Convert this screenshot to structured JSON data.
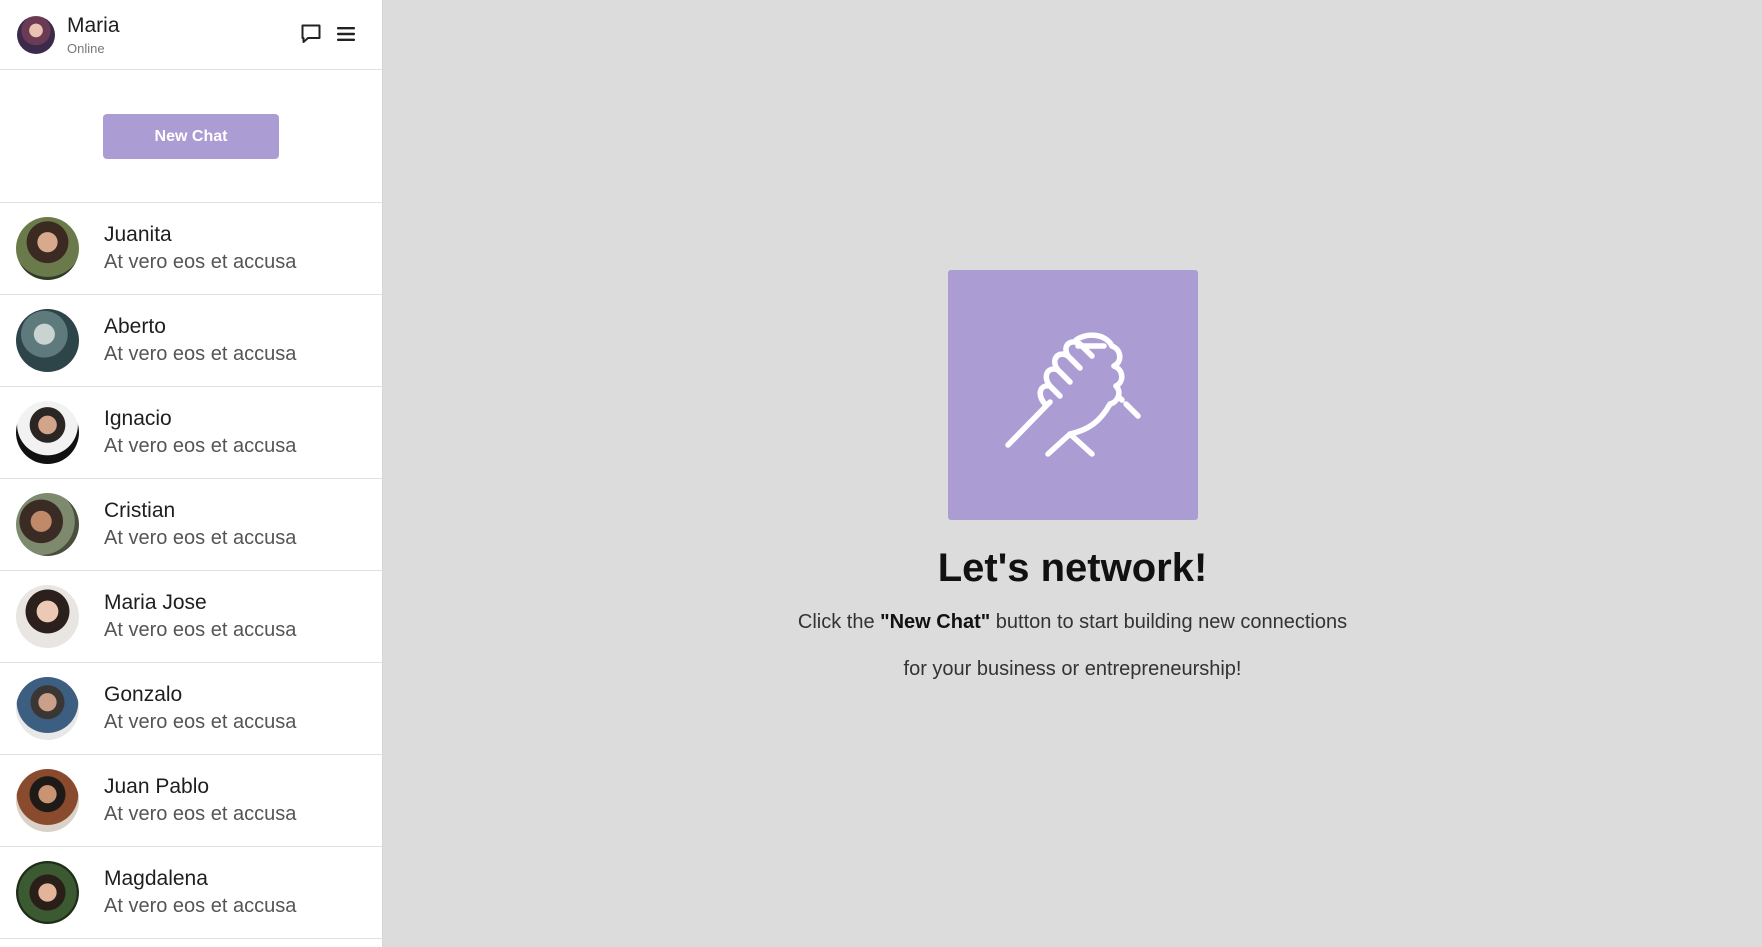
{
  "user": {
    "name": "Maria",
    "status": "Online"
  },
  "header_icons": [
    "chat-bubble-icon",
    "menu-icon"
  ],
  "new_chat_label": "New Chat",
  "contacts": [
    {
      "name": "Juanita",
      "preview": "At vero eos et accusa"
    },
    {
      "name": "Aberto",
      "preview": "At vero eos et accusa"
    },
    {
      "name": "Ignacio",
      "preview": "At vero eos et accusa"
    },
    {
      "name": "Cristian",
      "preview": "At vero eos et accusa"
    },
    {
      "name": "Maria Jose",
      "preview": "At vero eos et accusa"
    },
    {
      "name": "Gonzalo",
      "preview": "At vero eos et accusa"
    },
    {
      "name": "Juan Pablo",
      "preview": "At vero eos et accusa"
    },
    {
      "name": "Magdalena",
      "preview": "At vero eos et accusa"
    }
  ],
  "empty_state": {
    "icon": "handshake-icon",
    "title": "Let's network!",
    "line1_prefix": "Click the ",
    "line1_bold": "\"New Chat\"",
    "line1_suffix": " button to start building new connections",
    "line2": "for your business or entrepreneurship!"
  },
  "colors": {
    "accent": "#ac9cd4",
    "main_bg": "#dcdcdc",
    "sidebar_bg": "#ffffff"
  }
}
